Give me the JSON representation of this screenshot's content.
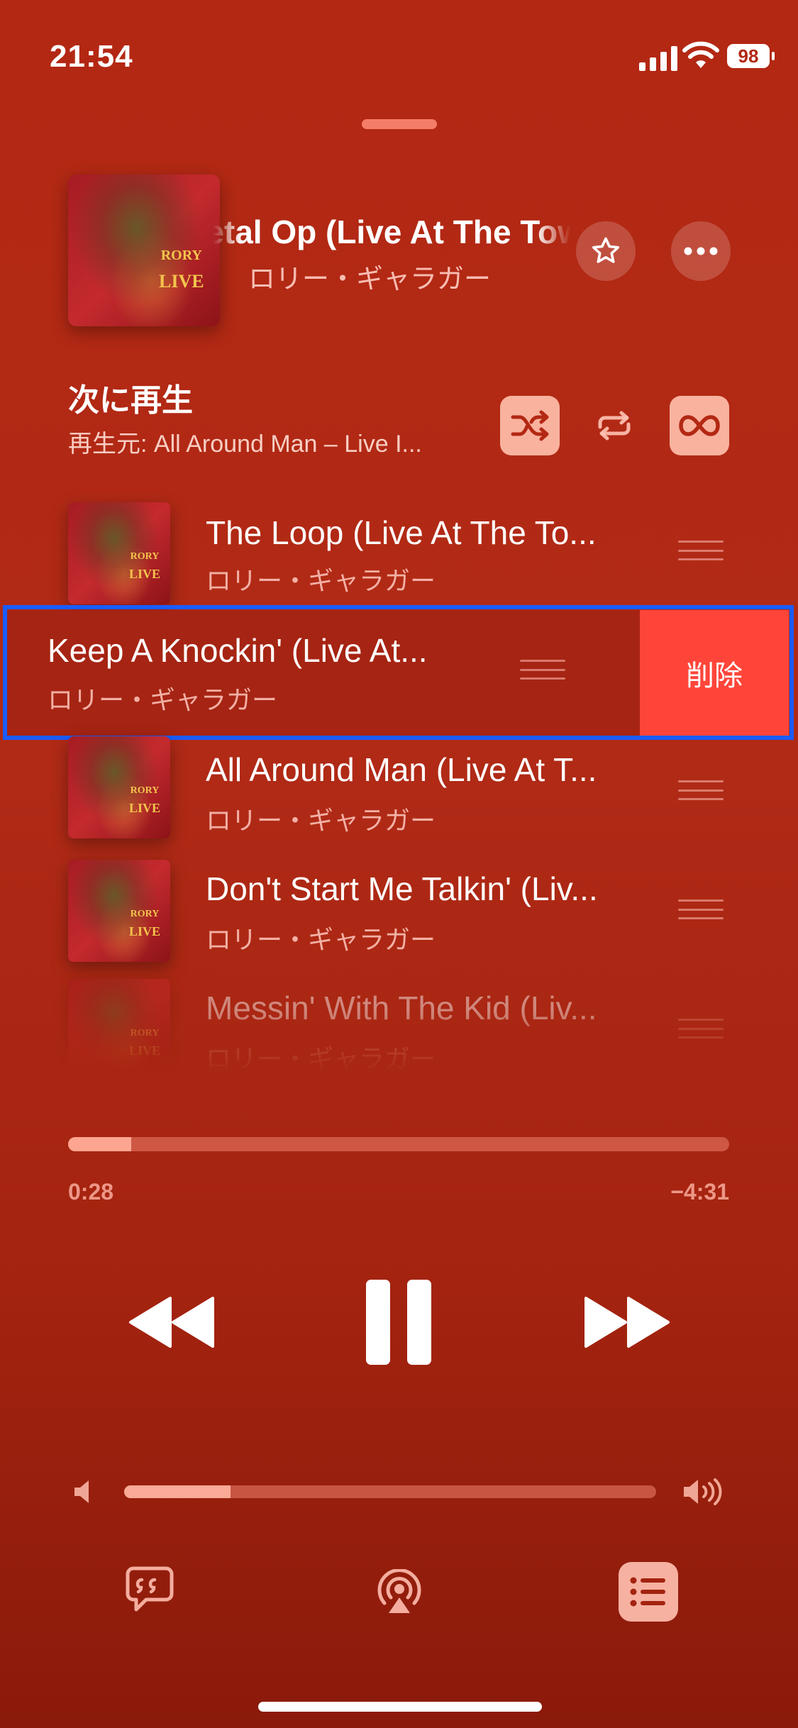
{
  "status_bar": {
    "time": "21:54",
    "battery": "98"
  },
  "now_playing": {
    "title": "Metal Op (Live At The Town Hall)",
    "artist": "ロリー・ギャラガー",
    "art": {
      "line1": "RORY",
      "line2": "LIVE"
    }
  },
  "queue_header": {
    "title": "次に再生",
    "source": "再生元: All Around Man – Live I...",
    "controls": {
      "shuffle": "shuffle-icon",
      "repeat": "repeat-icon",
      "autoplay": "infinity-icon"
    }
  },
  "queue": [
    {
      "title": "The Loop (Live At The To...",
      "artist": "ロリー・ギャラガー"
    },
    {
      "title": "Keep A Knockin' (Live At...",
      "artist": "ロリー・ギャラガー",
      "swiped": true,
      "action": "削除"
    },
    {
      "title": "All Around Man (Live At T...",
      "artist": "ロリー・ギャラガー"
    },
    {
      "title": "Don't Start Me Talkin' (Liv...",
      "artist": "ロリー・ギャラガー"
    },
    {
      "title": "Messin' With The Kid (Liv...",
      "artist": "ロリー・ギャラガー"
    }
  ],
  "playback": {
    "elapsed": "0:28",
    "remaining": "−4:31",
    "progress": 0.095
  },
  "volume": {
    "level": 0.2
  },
  "bottom_bar": {
    "lyrics": "lyrics-icon",
    "airplay": "airplay-icon",
    "queue": "list-icon"
  },
  "colors": {
    "background": "#b32813",
    "delete": "#ff453a",
    "highlight": "#1a5cff"
  }
}
